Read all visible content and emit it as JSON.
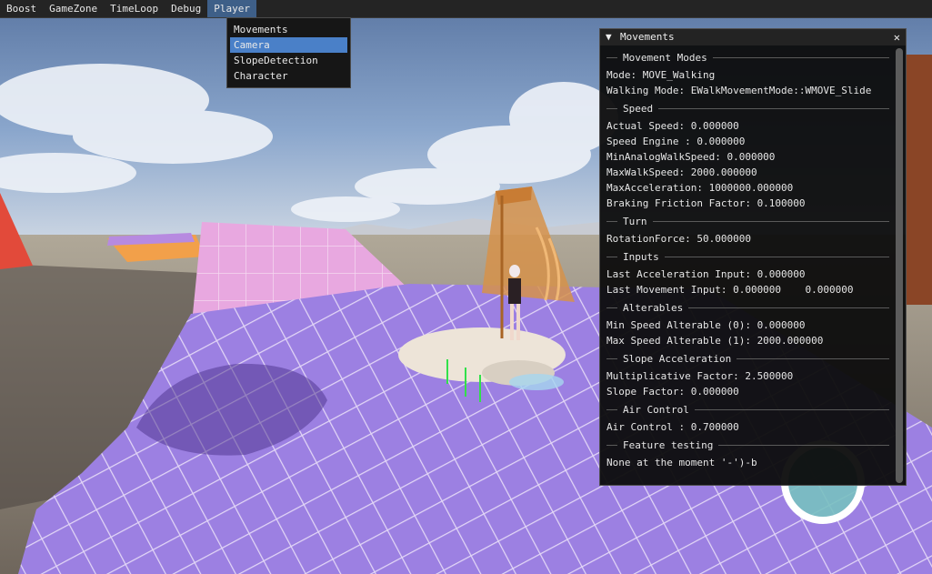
{
  "menu": {
    "items": [
      "Boost",
      "GameZone",
      "TimeLoop",
      "Debug",
      "Player"
    ],
    "active_index": 4
  },
  "dropdown": {
    "items": [
      "Movements",
      "Camera",
      "SlopeDetection",
      "Character"
    ],
    "selected_index": 1
  },
  "panel": {
    "title": "Movements",
    "collapse_icon": "▼",
    "close_icon": "✕",
    "sections": [
      {
        "header": "Movement Modes",
        "rows": [
          "Mode: MOVE_Walking",
          "Walking Mode: EWalkMovementMode::WMOVE_Slide"
        ]
      },
      {
        "header": "Speed",
        "rows": [
          "Actual Speed: 0.000000",
          "Speed Engine : 0.000000",
          "MinAnalogWalkSpeed: 0.000000",
          "MaxWalkSpeed: 2000.000000",
          "MaxAcceleration: 1000000.000000",
          "Braking Friction Factor: 0.100000"
        ]
      },
      {
        "header": "Turn",
        "rows": [
          "RotationForce: 50.000000"
        ]
      },
      {
        "header": "Inputs",
        "rows": [
          "Last Acceleration Input: 0.000000",
          "Last Movement Input: 0.000000    0.000000"
        ]
      },
      {
        "header": "Alterables",
        "rows": [
          "Min Speed Alterable (0): 0.000000",
          "Max Speed Alterable (1): 2000.000000"
        ]
      },
      {
        "header": "Slope Acceleration",
        "rows": [
          "Multiplicative Factor: 2.500000",
          "Slope Factor: 0.000000"
        ]
      },
      {
        "header": "Air Control",
        "rows": [
          "Air Control : 0.700000"
        ]
      },
      {
        "header": "Feature testing",
        "rows": [
          "None at the moment '-')-b"
        ]
      }
    ]
  },
  "colors": {
    "menu_active": "#3e5f88",
    "dropdown_selected": "#4a80c8",
    "floor_purple": "#9a7ee0",
    "ramp_pink": "#e4a4dc"
  }
}
